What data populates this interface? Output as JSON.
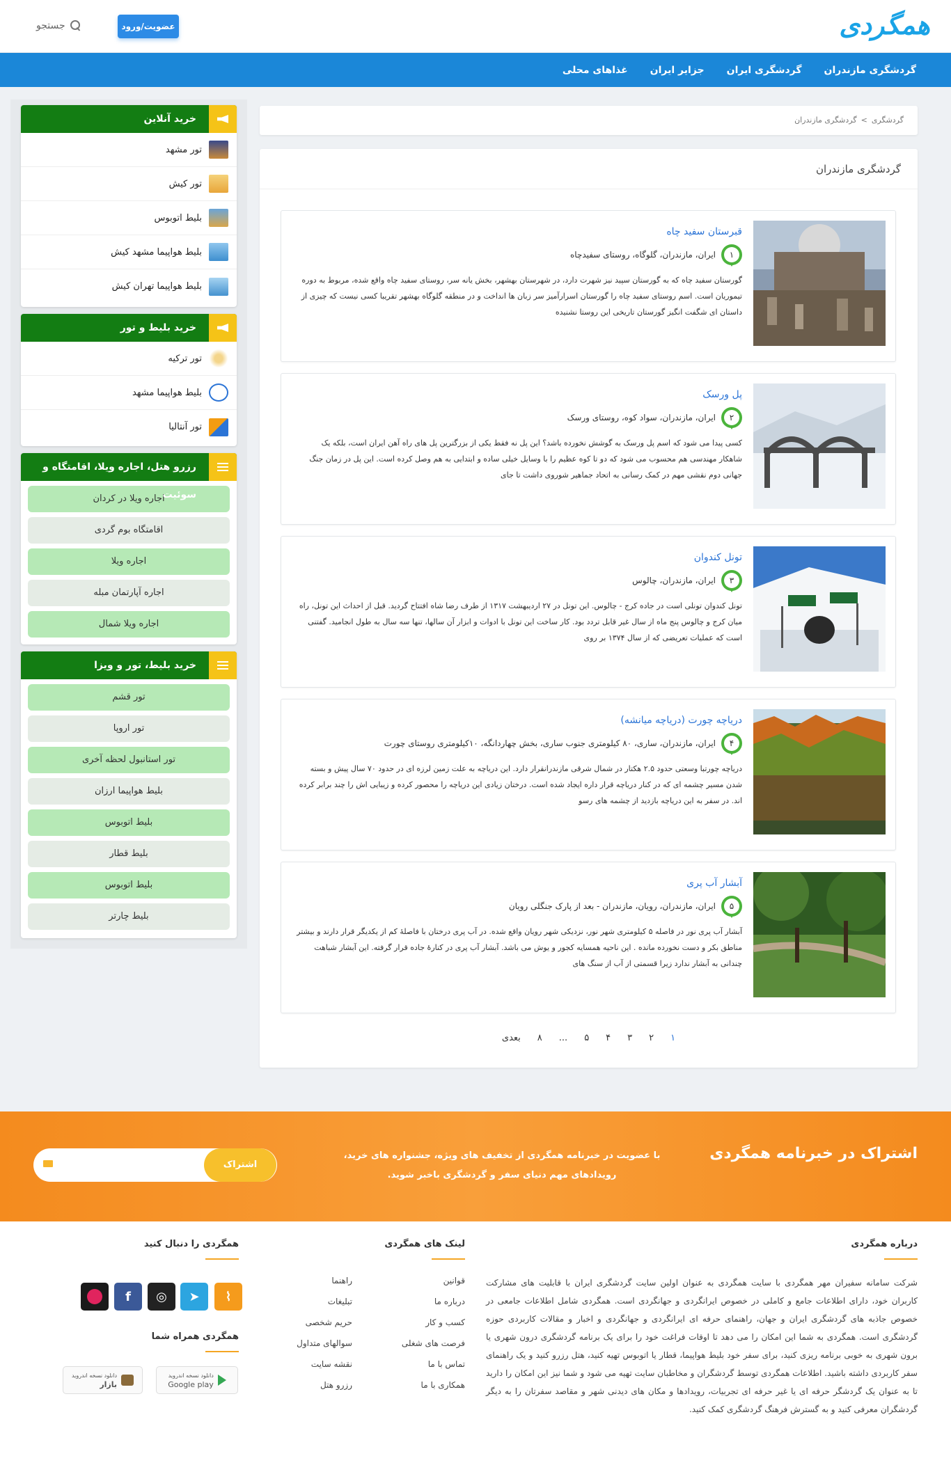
{
  "header": {
    "logo_text": "همگردی",
    "login_label": "عضویت/ورود",
    "search_label": "جستجو"
  },
  "nav": [
    "گردشگری مازندران",
    "گردشگری ایران",
    "جزایر ایران",
    "غذاهای محلی"
  ],
  "sidebar": {
    "online": {
      "title": "خرید آنلاین",
      "items": [
        "تور مشهد",
        "تور کیش",
        "بلیط اتوبوس",
        "بلیط هواپیما مشهد کیش",
        "بلیط هواپیما تهران کیش"
      ]
    },
    "ticket_tour": {
      "title": "خرید بلیط و تور",
      "items": [
        "تور ترکیه",
        "بلیط هواپیما مشهد",
        "تور آنتالیا"
      ]
    },
    "hotel": {
      "title": "رزرو هتل، اجاره ویلا، اقامتگاه و سوئیت",
      "items": [
        "اجاره ویلا در کردان",
        "اقامتگاه بوم گردی",
        "اجاره ویلا",
        "اجاره آپارتمان مبله",
        "اجاره ویلا شمال"
      ]
    },
    "visa": {
      "title": "خرید بلیط، تور و ویزا",
      "items": [
        "تور قشم",
        "تور اروپا",
        "تور استانبول لحظه آخری",
        "بلیط هواپیما ارزان",
        "بلیط اتوبوس",
        "بلیط قطار",
        "بلیط اتوبوس",
        "بلیط چارتر"
      ]
    }
  },
  "breadcrumb": {
    "root": "گردشگری",
    "sep": ">",
    "current": "گردشگری مازندران"
  },
  "page_title": "گردشگری مازندران",
  "cards": [
    {
      "num": "۱",
      "title": "قبرستان سفید چاه",
      "location": "ایران، مازندران، گلوگاه، روستای سفیدچاه",
      "desc": "گورستان سفید چاه که به گورستان سپید نیز شهرت دارد، در شهرستان بهشهر، بخش یانه سر، روستای سفید چاه واقع شده، مربوط به دوره تیموریان است. اسم روستای سفید چاه را گورستان اسرارآمیز سر زبان ها انداخت و در منطقه گلوگاه بهشهر تقریبا کسی نیست که چیزی از داستان ای شگفت انگیز گورستان تاریخی این روستا نشنیده"
    },
    {
      "num": "۲",
      "title": "پل ورسک",
      "location": "ایران، مازندران، سواد کوه، روستای ورسک",
      "desc": "کسی پیدا می شود که اسم پل ورسک به گوشش نخورده باشد؟ این پل نه فقط یکی از بزرگترین پل های راه آهن ایران است، بلکه یک شاهکار مهندسی هم محسوب می شود که دو تا کوه عظیم را با وسایل خیلی ساده و ابتدایی به هم وصل کرده است. این پل در زمان جنگ جهانی دوم نقشی مهم در کمک رسانی به اتحاد جماهیر شوروی داشت تا جای"
    },
    {
      "num": "۳",
      "title": "تونل کندوان",
      "location": "ایران، مازندران، چالوس",
      "desc": "تونل کندوان تونلی است در جاده کرج - چالوس. این تونل در ۲۷ اردیبهشت ۱۳۱۷ از طرف رضا شاه افتتاح گردید. قبل از احداث این تونل، راه میان کرج و چالوس پنج ماه از سال غیر قابل تردد بود. کار ساخت این تونل با ادوات و ابزار آن سالها، تنها سه سال به طول انجامید. گفتنی است که عملیات تعریضی که از سال ۱۳۷۴ بر روی"
    },
    {
      "num": "۴",
      "title": "دریاچه چورت (دریاچه میانشه)",
      "location": "ایران، مازندران، ساری، ۸۰ کیلومتری جنوب ساری، بخش چهاردانگه، ۱۰کیلومتری روستای چورت",
      "desc": "دریاچه چورتبا وسعتی حدود ۲.۵ هکتار در شمال شرقی مازندرانقرار دارد. این دریاچه به علت زمین لرزه ای در حدود ۷۰ سال پیش و بسته شدن مسیر چشمه ای که در کنار دریاچه قرار داره ایجاد شده است. درختان زیادی این دریاچه را محصور کرده و زیبایی اش را چند برابر کرده اند. در سفر به این دریاچه بازدید از چشمه های رسو"
    },
    {
      "num": "۵",
      "title": "آبشار آب پری",
      "location": "ایران، مازندران، رویان، مازندران - بعد از پارک جنگلی رویان",
      "desc": "آبشار آب پری نور در فاصله ۵ کیلومتری شهر نور، نزدیکی شهر رویان واقع شده. در آب پری درختان با فاصلهٔ کم از یکدیگر قرار دارند و بیشتر مناطق بکر و دست نخورده مانده . این ناحیه همسایه کجور و یوش می باشد. آبشار آب پری در کنارهٔ جاده قرار گرفته. این آبشار شباهت چندانی به آبشار ندارد زیرا قسمتی از آب از سنگ های"
    }
  ],
  "pagination": [
    "۱",
    "۲",
    "۳",
    "۴",
    "۵",
    "...",
    "۸",
    "بعدی"
  ],
  "newsletter": {
    "title": "اشتراک در خبرنامه همگردی",
    "desc": "با عضویت در خبرنامه همگردی از تخفیف های ویژه، جشنواره های خرید، رویدادهای مهم دنیای سفر و گردشگری باخبر شوید.",
    "button": "اشتراک"
  },
  "footer": {
    "about_title": "درباره همگردی",
    "about_text": "شرکت سامانه سفیران مهر همگردی با سایت همگردی به عنوان اولین سایت گردشگری ایران با قابلیت های مشارکت کاربران خود، دارای اطلاعات جامع و کاملی در خصوص ایرانگردی و جهانگردی است. همگردی شامل اطلاعات جامعی در خصوص جاذبه های گردشگری ایران و جهان، راهنمای حرفه ای ایرانگردی و جهانگردی و اخبار و مقالات کاربردی حوزه گردشگری است. همگردی به شما این امکان را می دهد تا اوقات فراغت خود را برای یک برنامه گردشگری درون شهری یا برون شهری به خوبی برنامه ریزی کنید، برای سفر خود بلیط هواپیما، قطار یا اتوبوس تهیه کنید، هتل رزرو کنید و یک راهنمای سفر کاربردی داشته باشید. اطلاعات همگردی توسط گردشگران و مخاطبان سایت تهیه می شود و شما نیز این امکان را دارید تا به عنوان یک گردشگر حرفه ای یا غیر حرفه ای تجربیات، رویدادها و مکان های دیدنی شهر و مقاصد سفرتان را به دیگر گردشگران معرفی کنید و به گسترش فرهنگ گردشگری کمک کنید.",
    "links_title": "لینک های همگردی",
    "links_col1": [
      "قوانین",
      "درباره ما",
      "کسب و کار",
      "فرصت های شغلی",
      "تماس با ما",
      "همکاری با ما"
    ],
    "links_col2": [
      "راهنما",
      "تبلیغات",
      "حریم شخصی",
      "سوالهای متداول",
      "نقشه سایت",
      "رزرو هتل"
    ],
    "follow_title": "همگردی را دنبال کنید",
    "app_title": "همگردی همراه شما",
    "app_google_top": "دانلود نسخه اندروید",
    "app_google": "Google play",
    "app_bazaar_top": "دانلود نسخه اندروید",
    "app_bazaar": "بازار"
  },
  "colors": {
    "brand_blue": "#1b87d8",
    "sidebar_green": "#137d13",
    "accent_yellow": "#f5c317",
    "orange": "#f48b1e"
  }
}
